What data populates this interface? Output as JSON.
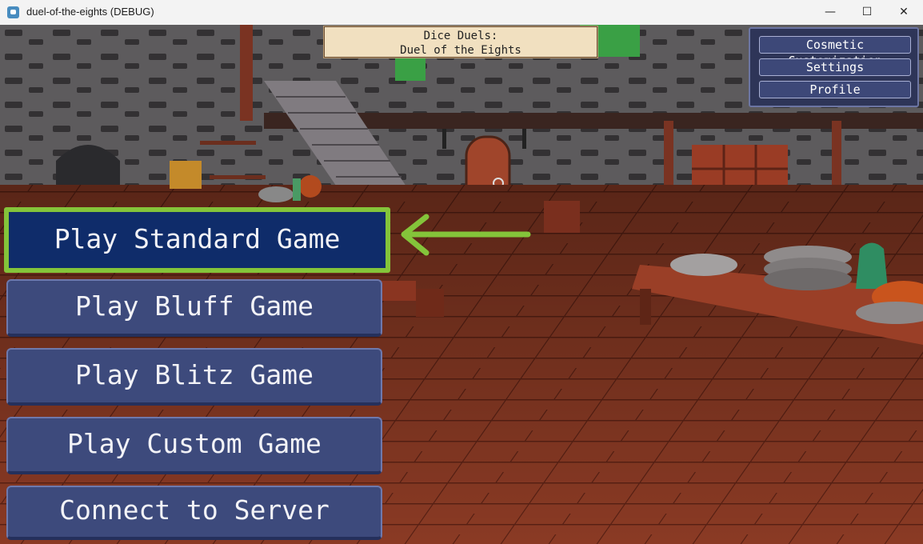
{
  "window": {
    "title": "duel-of-the-eights (DEBUG)",
    "minimize": "—",
    "maximize": "☐",
    "close": "✕"
  },
  "banner": {
    "line1": "Dice Duels:",
    "line2": "Duel of the Eights"
  },
  "top_menu": {
    "cosmetic": "Cosmetic Customization",
    "settings": "Settings",
    "profile": "Profile"
  },
  "main_menu": {
    "standard": "Play Standard Game",
    "bluff": "Play Bluff Game",
    "blitz": "Play Blitz Game",
    "custom": "Play Custom Game",
    "connect": "Connect to Server"
  },
  "colors": {
    "highlight": "#84c43a",
    "button": "#3d4a7c",
    "selected_button": "#0f2c6a"
  },
  "icons": {
    "app": "godot-icon",
    "pointer": "arrow-left-icon"
  }
}
